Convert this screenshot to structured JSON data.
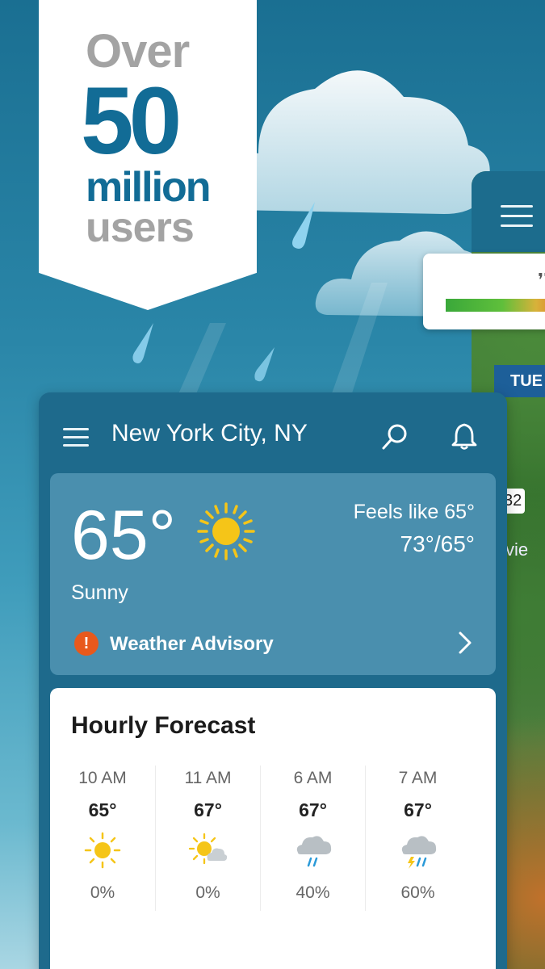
{
  "promo": {
    "line1": "Over",
    "line2": "50",
    "line3": "million",
    "line4": "users"
  },
  "radar": {
    "day": "TUE",
    "shield": "32",
    "town": "vie"
  },
  "header": {
    "city": "New York City, NY"
  },
  "current": {
    "temp": "65°",
    "icon": "sun-icon",
    "feels_like": "Feels like 65°",
    "hi_lo": "73°/65°",
    "condition": "Sunny",
    "advisory": "Weather Advisory"
  },
  "hourly": {
    "title": "Hourly Forecast",
    "items": [
      {
        "time": "10 AM",
        "temp": "65°",
        "icon": "sun-icon",
        "precip": "0%"
      },
      {
        "time": "11 AM",
        "temp": "67°",
        "icon": "partly-cloudy-icon",
        "precip": "0%"
      },
      {
        "time": "6 AM",
        "temp": "67°",
        "icon": "rain-cloud-icon",
        "precip": "40%"
      },
      {
        "time": "7 AM",
        "temp": "67°",
        "icon": "thunderstorm-icon",
        "precip": "60%"
      }
    ]
  },
  "colors": {
    "brand": "#126c96",
    "header_bg": "#1e6a8c",
    "advisory": "#e8591c",
    "sun": "#f5c518"
  }
}
